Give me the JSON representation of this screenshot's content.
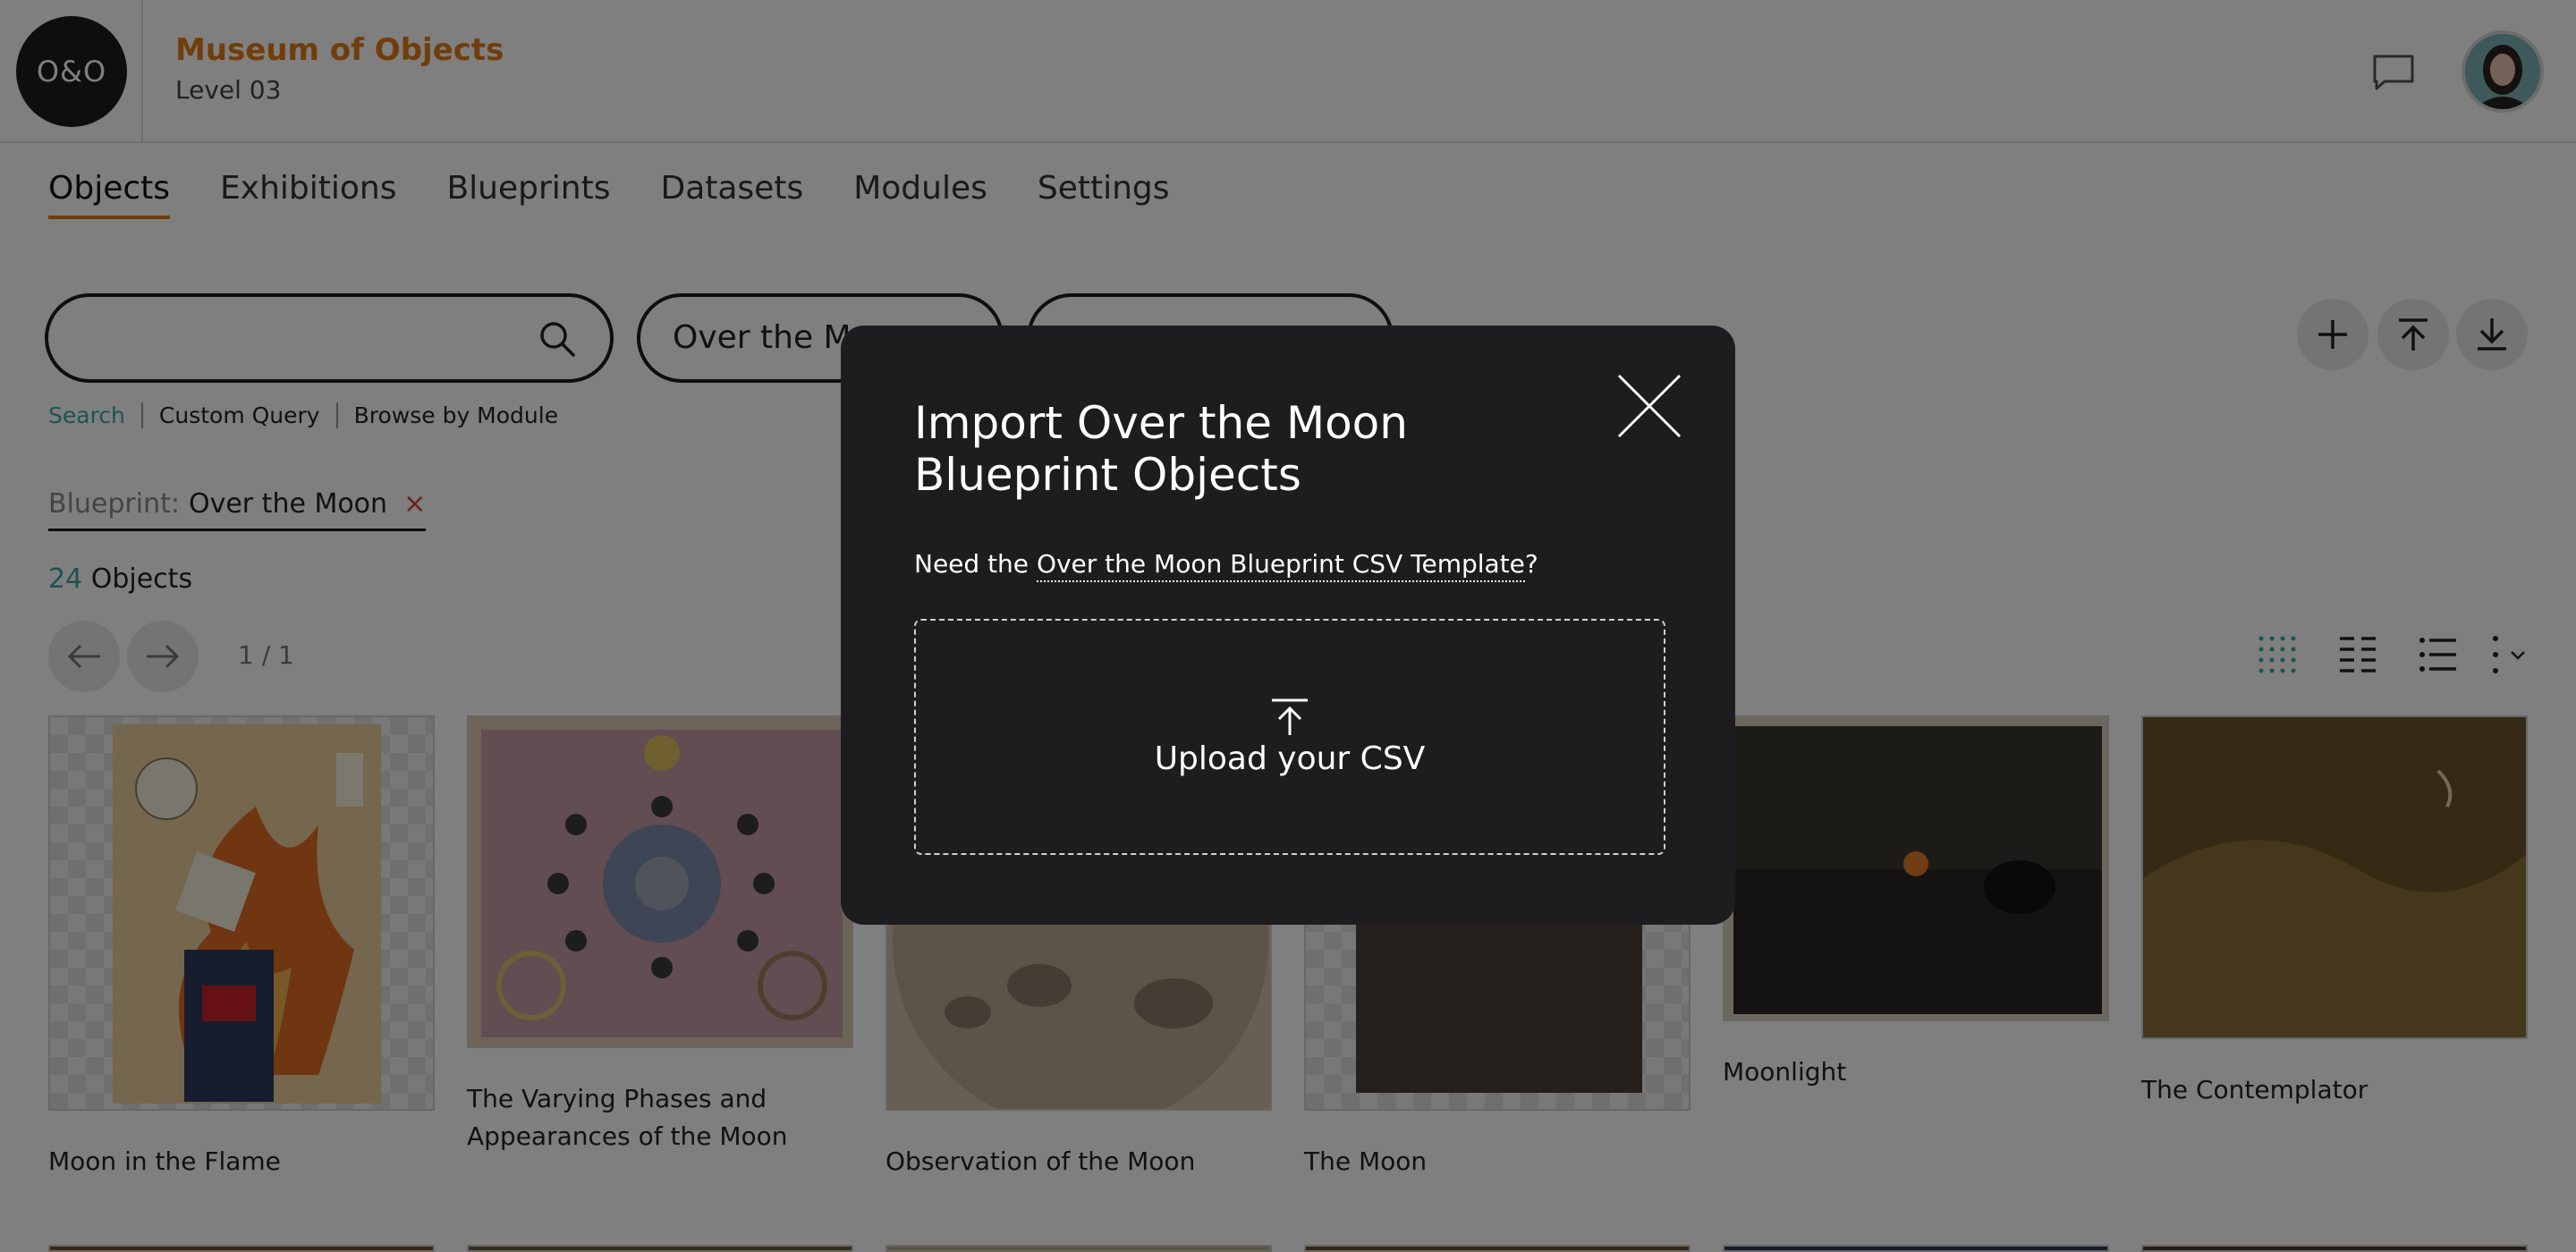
{
  "header": {
    "logo_text": "O&O",
    "museum_name": "Museum of Objects",
    "level": "Level 03",
    "icons": {
      "chat": "chat-bubble-icon",
      "avatar": "user-avatar"
    }
  },
  "tabs": [
    {
      "label": "Objects",
      "active": true
    },
    {
      "label": "Exhibitions"
    },
    {
      "label": "Blueprints"
    },
    {
      "label": "Datasets"
    },
    {
      "label": "Modules"
    },
    {
      "label": "Settings"
    }
  ],
  "search": {
    "placeholder": "",
    "blueprint_pill": "Over the Moon",
    "second_pill": "",
    "links": [
      "Search",
      "Custom Query",
      "Browse by Module"
    ]
  },
  "actions": {
    "add": "plus-icon",
    "upload": "upload-icon",
    "download": "download-icon"
  },
  "filter": {
    "key": "Blueprint:",
    "value": "Over the Moon",
    "remove": "×"
  },
  "count": {
    "number": "24",
    "label": "Objects"
  },
  "pager": {
    "page": "1 / 1"
  },
  "view_modes": [
    "grid-dots-icon",
    "grid-list-icon",
    "list-icon",
    "column-options-icon"
  ],
  "objects": [
    {
      "title": "Moon in the Flame"
    },
    {
      "title_line1": "The Varying Phases and",
      "title_line2": "Appearances of the Moon"
    },
    {
      "title": "Observation of the Moon"
    },
    {
      "title": "The Moon"
    },
    {
      "title": "Moonlight"
    },
    {
      "title": "The Contemplator"
    }
  ],
  "modal": {
    "title_line1": "Import Over the Moon",
    "title_line2": "Blueprint Objects",
    "hint_prefix": "Need the ",
    "hint_link": "Over the Moon Blueprint CSV Template",
    "hint_suffix": "?",
    "upload_label": "Upload your CSV"
  },
  "colors": {
    "accent_orange": "#e07d16",
    "accent_teal": "#3aa6a6",
    "remove_red": "#d2452a",
    "modal_bg": "#1d1d1f"
  }
}
